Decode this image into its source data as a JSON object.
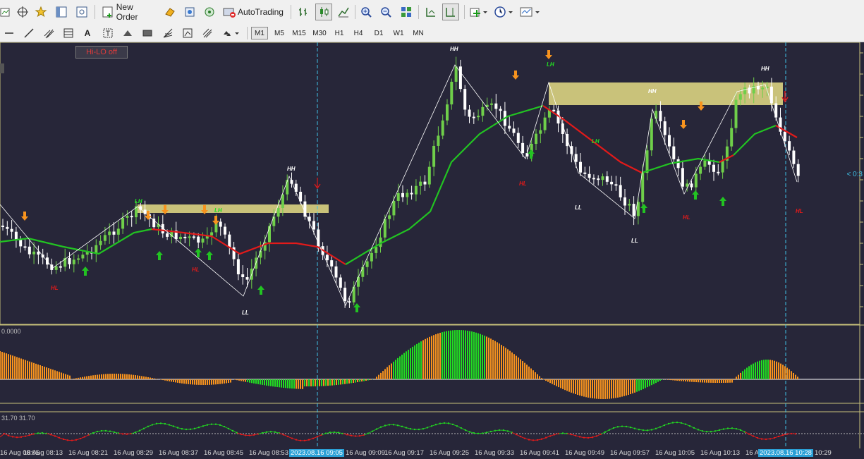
{
  "toolbar_main": {
    "new_order_label": "New Order",
    "autotrading_label": "AutoTrading",
    "icons": [
      "new-chart-icon",
      "crosshair-icon",
      "favorites-icon",
      "navigator-icon",
      "data-window-icon",
      "new-order-icon",
      "market-watch-icon",
      "strategy-tester-icon",
      "signals-icon",
      "autotrading-icon",
      "bar-chart-icon",
      "candlestick-icon",
      "line-chart-icon",
      "zoom-in-icon",
      "zoom-out-icon",
      "tile-windows-icon",
      "scroll-chart-icon",
      "chart-shift-icon",
      "indicators-icon",
      "periods-icon",
      "templates-icon"
    ]
  },
  "toolbar_draw": {
    "text_tool_label": "A",
    "icons": [
      "horizontal-line-icon",
      "trendline-icon",
      "equidistant-channel-icon",
      "fibo-retracement-icon",
      "text-icon",
      "text-label-icon",
      "arrow-up-shape-icon",
      "rectangle-icon",
      "fibo-fan-icon",
      "cycle-lines-icon",
      "channel-icon",
      "arrows-dropdown-icon"
    ]
  },
  "timeframes": [
    "M1",
    "M5",
    "M15",
    "M30",
    "H1",
    "H4",
    "D1",
    "W1",
    "MN"
  ],
  "active_timeframe": "M1",
  "chart": {
    "hilo_button": "Hi-LO off",
    "price_tag": "< 0:3",
    "sub1_label": "0.0000",
    "sub2_label": "31.70 31.70",
    "colors": {
      "background": "#272639",
      "bull": "#6fcf4a",
      "bear": "#ffffff",
      "ma_green": "#22c322",
      "ma_red": "#e21a1a",
      "histo_green": "#22dd22",
      "histo_orange": "#f7931e",
      "zone": "#c9c27a",
      "cursor": "#3fc1e6",
      "arrow_up": "#22c322",
      "arrow_down": "#f7931e"
    },
    "swing_labels": [
      {
        "text": "HH",
        "color": "white"
      },
      {
        "text": "HH",
        "color": "white"
      },
      {
        "text": "HH",
        "color": "white"
      },
      {
        "text": "HH",
        "color": "white"
      },
      {
        "text": "LH",
        "color": "green"
      },
      {
        "text": "LH",
        "color": "green"
      },
      {
        "text": "LH",
        "color": "green"
      },
      {
        "text": "LH",
        "color": "green"
      },
      {
        "text": "HL",
        "color": "red"
      },
      {
        "text": "HL",
        "color": "red"
      },
      {
        "text": "HL",
        "color": "red"
      },
      {
        "text": "HL",
        "color": "red"
      },
      {
        "text": "HL",
        "color": "red"
      },
      {
        "text": "LL",
        "color": "white"
      },
      {
        "text": "LL",
        "color": "white"
      },
      {
        "text": "LL",
        "color": "white"
      }
    ],
    "time_axis": [
      {
        "text": "16 Aug 08:05",
        "highlight": false
      },
      {
        "text": "16 Aug 08:13",
        "highlight": false
      },
      {
        "text": "16 Aug 08:21",
        "highlight": false
      },
      {
        "text": "16 Aug 08:29",
        "highlight": false
      },
      {
        "text": "16 Aug 08:37",
        "highlight": false
      },
      {
        "text": "16 Aug 08:45",
        "highlight": false
      },
      {
        "text": "16 Aug 08:53",
        "highlight": false
      },
      {
        "text": "2023.08.16 09:05",
        "highlight": true
      },
      {
        "text": "16 Aug 09:09",
        "highlight": false
      },
      {
        "text": "16 Aug 09:17",
        "highlight": false
      },
      {
        "text": "16 Aug 09:25",
        "highlight": false
      },
      {
        "text": "16 Aug 09:33",
        "highlight": false
      },
      {
        "text": "16 Aug 09:41",
        "highlight": false
      },
      {
        "text": "16 Aug 09:49",
        "highlight": false
      },
      {
        "text": "16 Aug 09:57",
        "highlight": false
      },
      {
        "text": "16 Aug 10:05",
        "highlight": false
      },
      {
        "text": "16 Aug 10:13",
        "highlight": false
      },
      {
        "text": "16 A",
        "highlight": false
      },
      {
        "text": "2023.08.16 10:28",
        "highlight": true
      },
      {
        "text": "10:29",
        "highlight": false
      }
    ]
  }
}
